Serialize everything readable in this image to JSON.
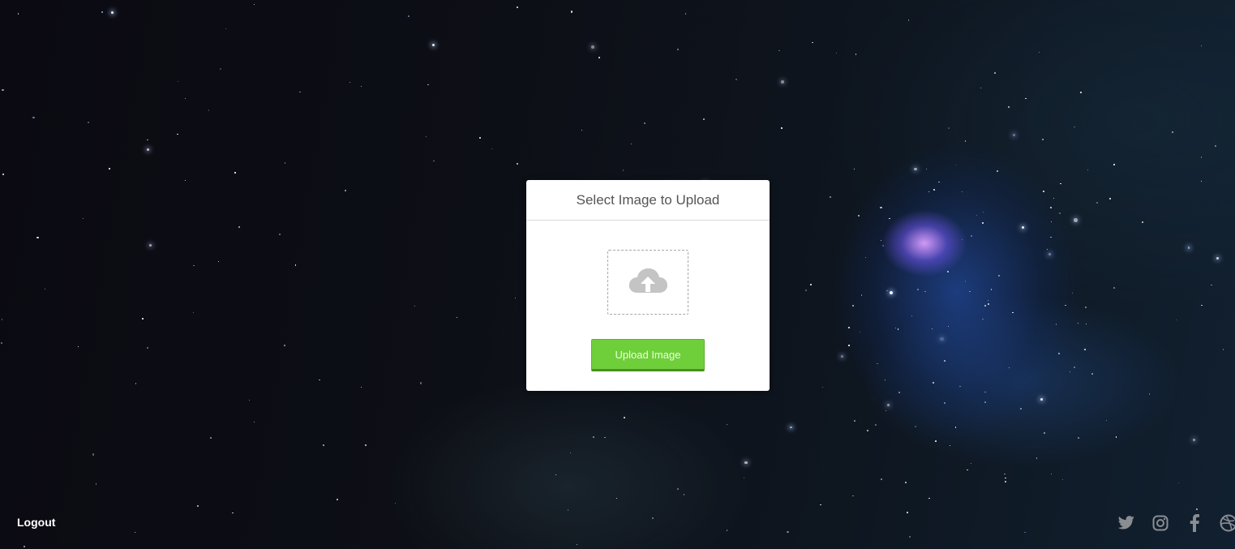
{
  "upload_card": {
    "title": "Select Image to Upload",
    "dropzone_icon": "cloud-upload-icon",
    "upload_button_label": "Upload Image"
  },
  "footer": {
    "logout_label": "Logout",
    "social_icons": [
      "twitter-icon",
      "instagram-icon",
      "facebook-icon",
      "dribbble-icon"
    ]
  },
  "colors": {
    "accent_green": "#6fcf3a",
    "icon_gray": "#c4c4c4",
    "social_gray": "#8a8d92"
  }
}
